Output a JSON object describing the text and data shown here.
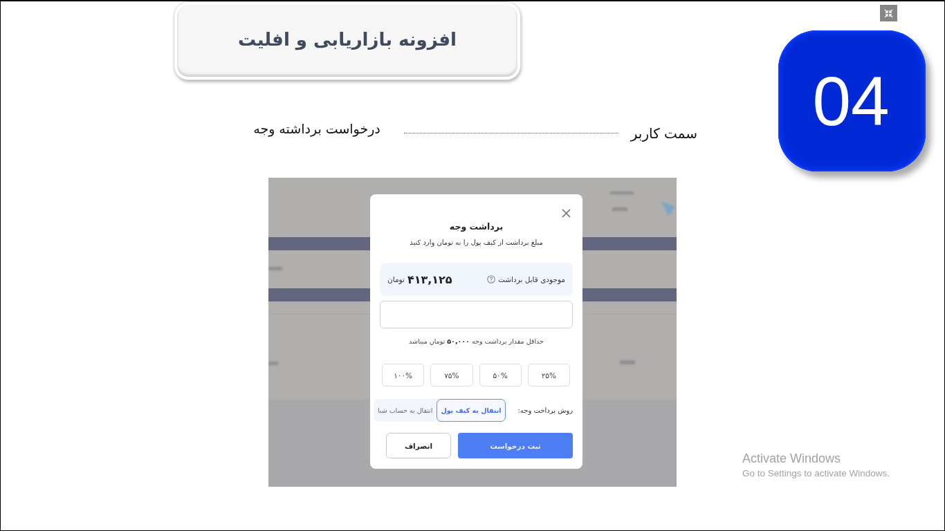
{
  "slide": {
    "title": "افزونه بازاریابی و افلیت",
    "step_number": "04",
    "breadcrumb": {
      "section": "سمت کاربر",
      "topic": "درخواست برداشته وجه"
    },
    "screenshot": {
      "dialog": {
        "title": "برداشت وجه",
        "subtitle": "مبلغ برداشت از کیف پول را به تومان وارد کنید",
        "balance": {
          "label": "موجودی قابل برداشت",
          "amount": "۴۱۳,۱۲۵",
          "currency": "تومان"
        },
        "minimum_note": "حداقل مقدار برداشت وجه **۵۰,۰۰۰** تومان میباشد",
        "percent_buttons": [
          "۲۵%",
          "۵۰%",
          "۷۵%",
          "۱۰۰%"
        ],
        "payment_method": {
          "label": "روش پرداخت وجه:",
          "options": [
            {
              "label": "انتقال به کیف پول",
              "selected": true
            },
            {
              "label": "انتقال به حساب شبا",
              "selected": false
            }
          ]
        },
        "buttons": [
          {
            "label": "ثبت درخواست",
            "kind": "primary"
          },
          {
            "label": "انصراف",
            "kind": "secondary"
          }
        ]
      }
    }
  },
  "windows_activation": {
    "title": "Activate Windows",
    "message": "Go to Settings to activate Windows."
  }
}
